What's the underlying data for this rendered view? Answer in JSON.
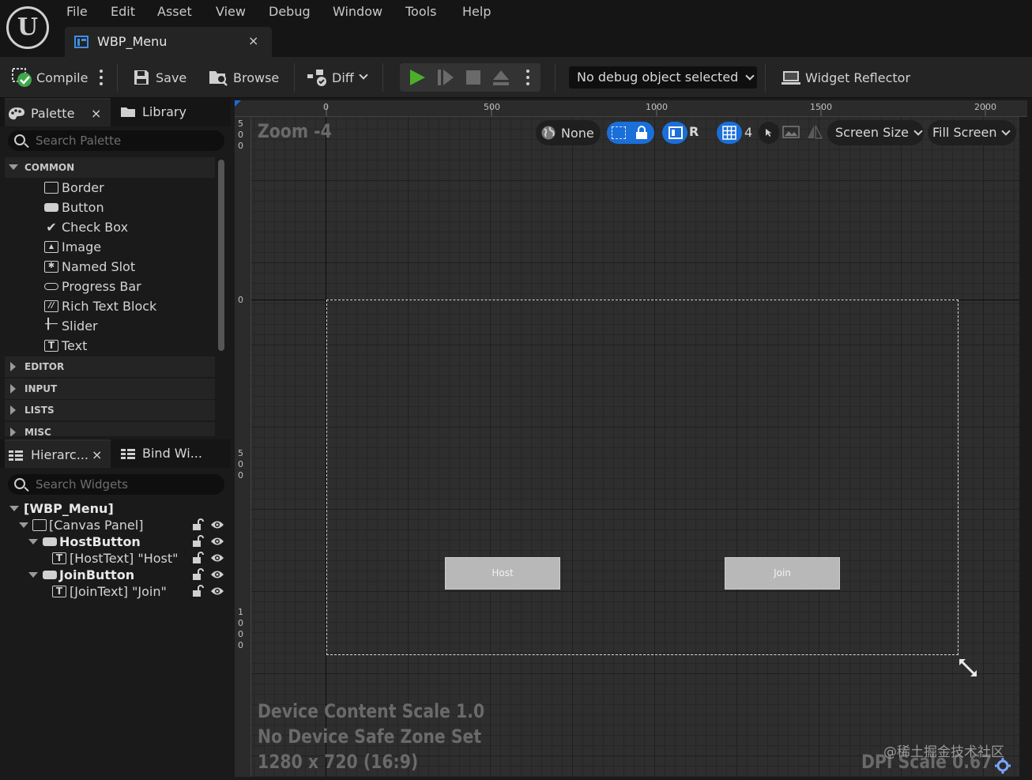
{
  "app": {
    "logo_text": "U"
  },
  "menu": [
    "File",
    "Edit",
    "Asset",
    "View",
    "Debug",
    "Window",
    "Tools",
    "Help"
  ],
  "doc_tab": {
    "label": "WBP_Menu",
    "close": "×"
  },
  "toolbar": {
    "compile": "Compile",
    "save": "Save",
    "browse": "Browse",
    "diff": "Diff",
    "debug_object": "No debug object selected",
    "widget_reflector": "Widget Reflector"
  },
  "palette": {
    "tab_label": "Palette",
    "tab_close": "×",
    "library_tab": "Library",
    "search_placeholder": "Search Palette",
    "categories": {
      "common": "COMMON",
      "editor": "EDITOR",
      "input": "INPUT",
      "lists": "LISTS",
      "misc": "MISC"
    },
    "items": [
      {
        "label": "Border",
        "icon": "border-icon"
      },
      {
        "label": "Button",
        "icon": "button-icon"
      },
      {
        "label": "Check Box",
        "icon": "checkbox-icon"
      },
      {
        "label": "Image",
        "icon": "image-icon"
      },
      {
        "label": "Named Slot",
        "icon": "named-slot-icon"
      },
      {
        "label": "Progress Bar",
        "icon": "progress-bar-icon"
      },
      {
        "label": "Rich Text Block",
        "icon": "rich-text-icon"
      },
      {
        "label": "Slider",
        "icon": "slider-icon"
      },
      {
        "label": "Text",
        "icon": "text-icon"
      }
    ]
  },
  "hierarchy": {
    "tab_label": "Hierarc...",
    "tab_close": "×",
    "bind_tab": "Bind Wi...",
    "search_placeholder": "Search Widgets",
    "rows": [
      {
        "label": "[WBP_Menu]"
      },
      {
        "label": "[Canvas Panel]"
      },
      {
        "label": "HostButton"
      },
      {
        "label": "[HostText] \"Host\""
      },
      {
        "label": "JoinButton"
      },
      {
        "label": "[JoinText] \"Join\""
      }
    ]
  },
  "viewport": {
    "zoom": "Zoom -4",
    "ruler_top": [
      "0",
      "500",
      "1000",
      "1500",
      "2000"
    ],
    "ruler_left": [
      "500",
      "0",
      "500",
      "1000"
    ],
    "localization": "None",
    "r_label": "R",
    "grid_value": "4",
    "screen_size": "Screen Size",
    "fill_screen": "Fill Screen",
    "host_button": "Host",
    "join_button": "Join",
    "device_scale": "Device Content Scale 1.0",
    "safe_zone": "No Device Safe Zone Set",
    "resolution": "1280 x 720 (16:9)",
    "dpi_scale": "DPI Scale 0.67",
    "watermark": "@稀土掘金技术社区"
  },
  "colors": {
    "accent_blue": "#1a6fd9",
    "play_green": "#4caf2a"
  }
}
